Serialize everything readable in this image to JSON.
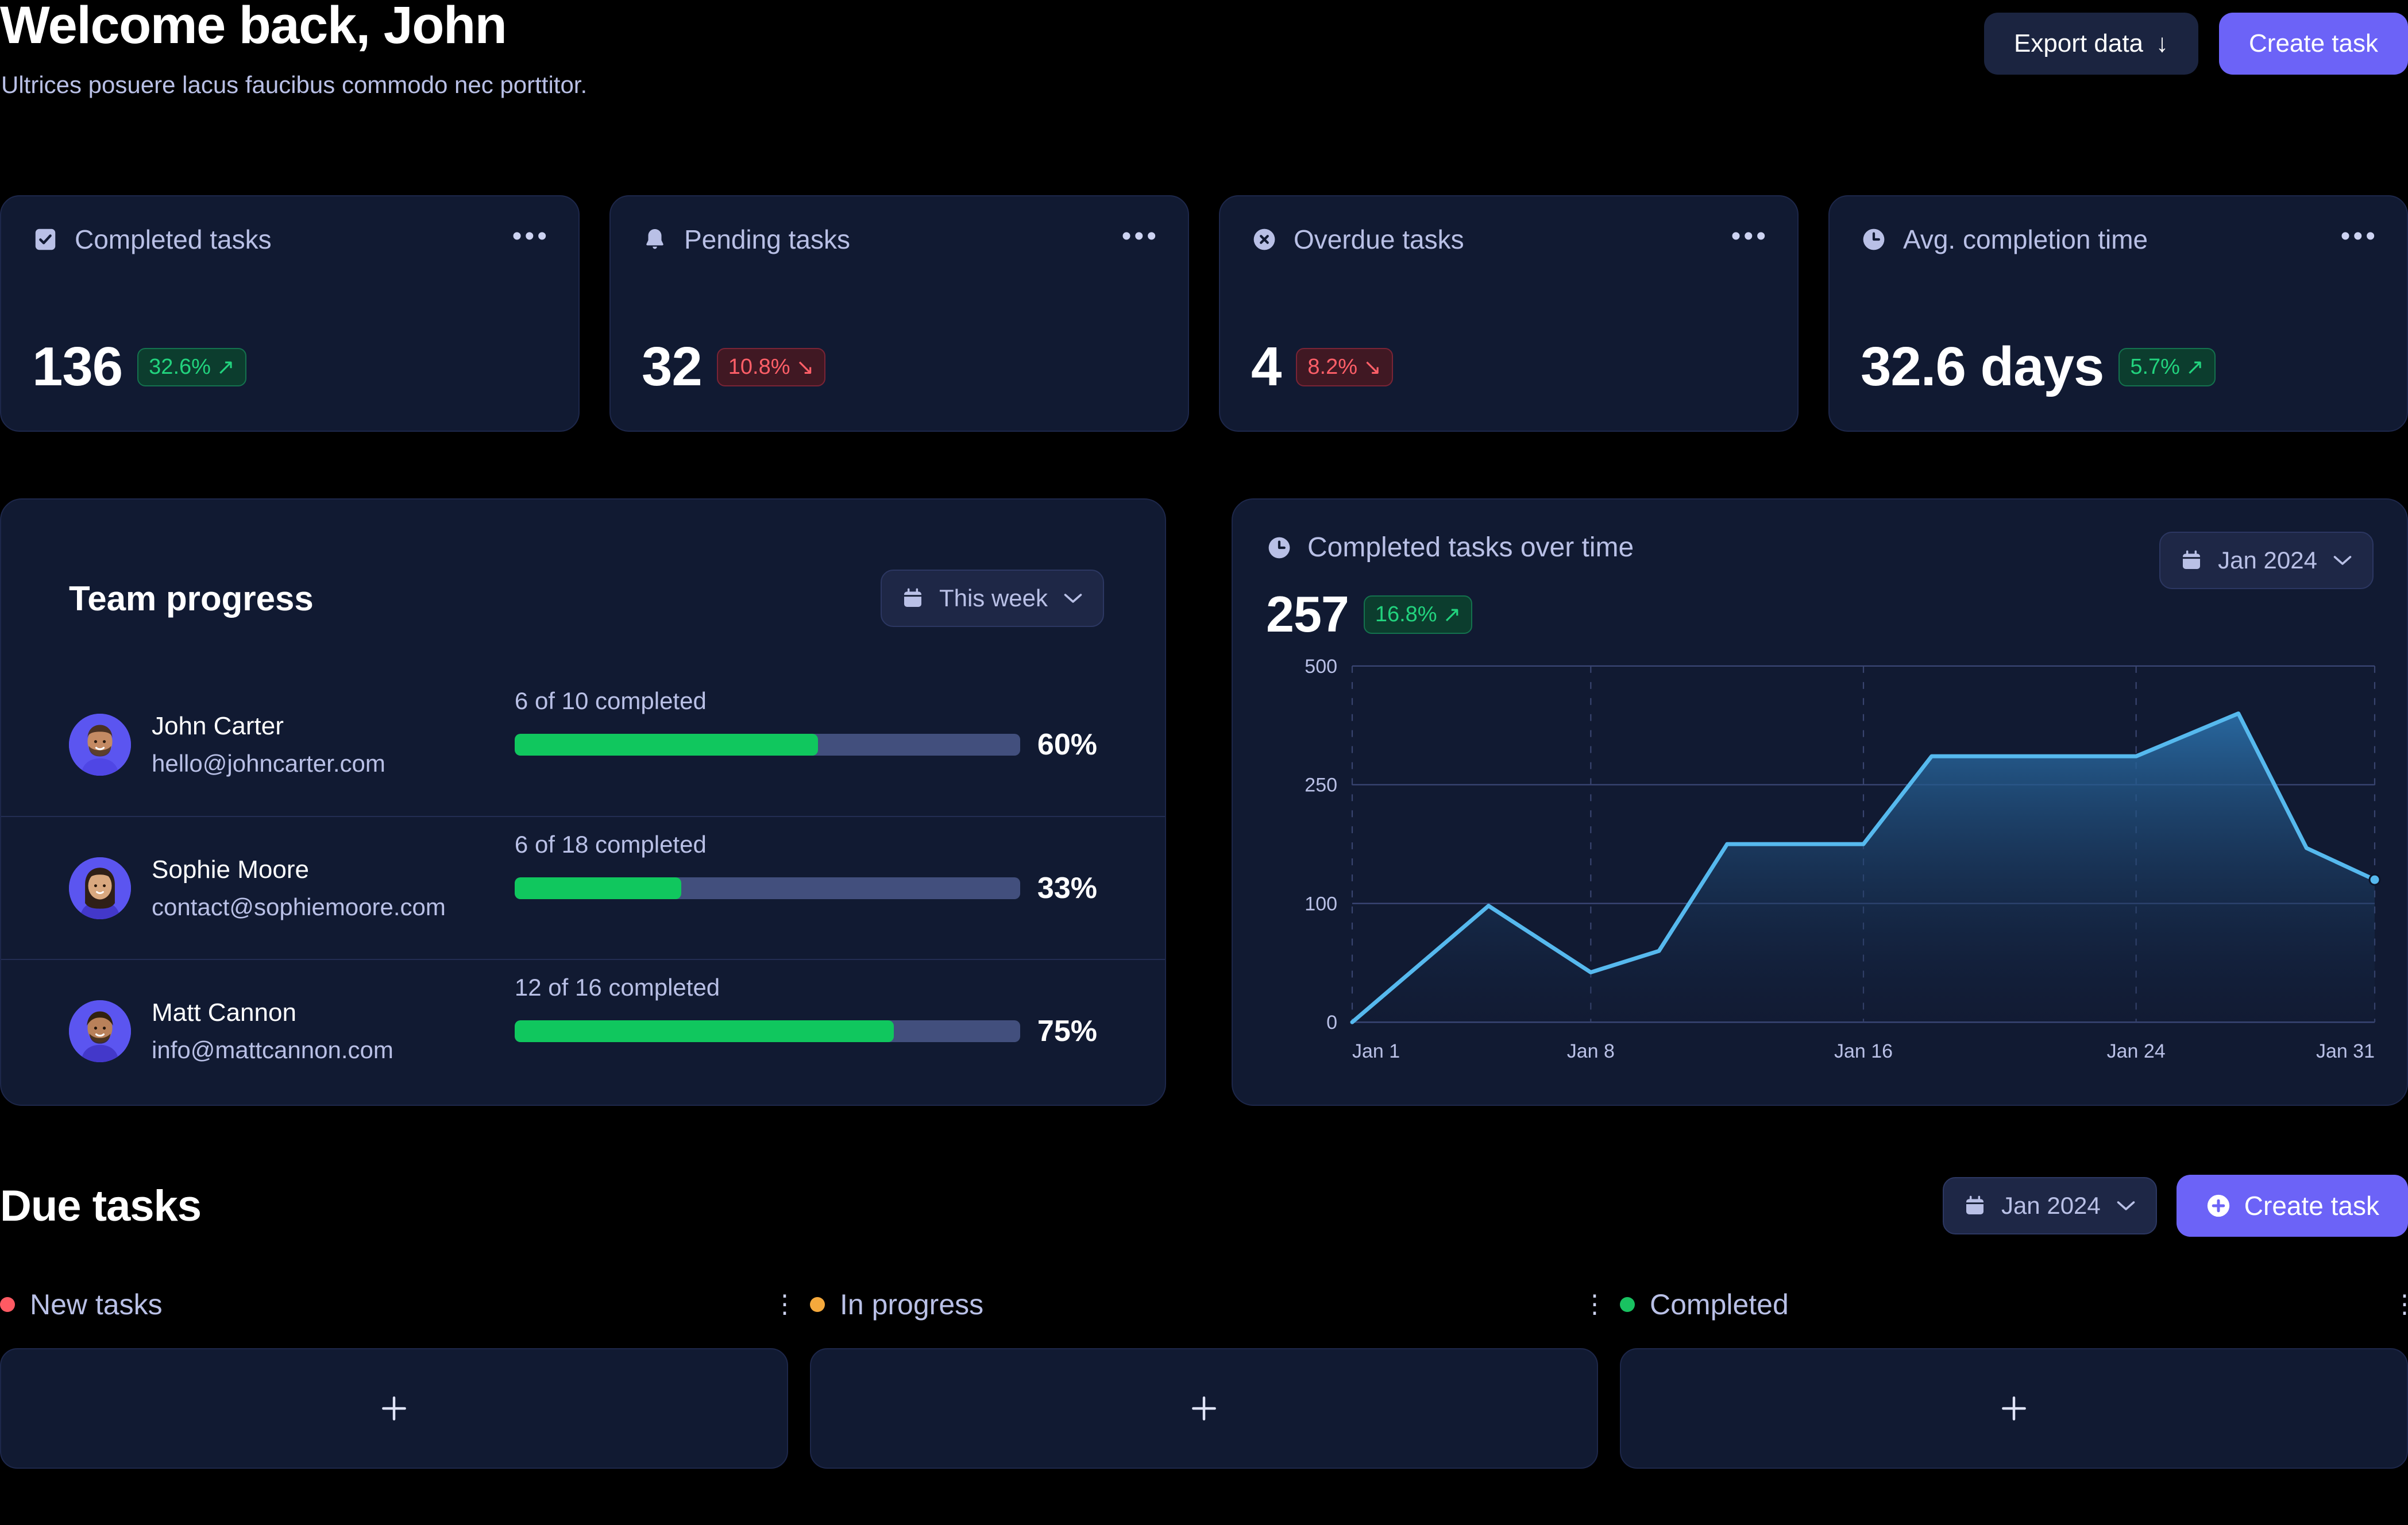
{
  "header": {
    "title": "Welcome back, John",
    "subtitle": "Ultrices posuere lacus faucibus commodo nec porttitor.",
    "export_label": "Export data",
    "export_icon": "download-arrow-icon",
    "create_label": "Create task"
  },
  "stats": [
    {
      "icon": "checkbox-icon",
      "label": "Completed tasks",
      "value": "136",
      "delta": "32.6%",
      "trend": "up",
      "trend_icon": "arrow-up-right-icon"
    },
    {
      "icon": "bell-icon",
      "label": "Pending tasks",
      "value": "32",
      "delta": "10.8%",
      "trend": "down",
      "trend_icon": "arrow-down-right-icon"
    },
    {
      "icon": "x-circle-icon",
      "label": "Overdue tasks",
      "value": "4",
      "delta": "8.2%",
      "trend": "down",
      "trend_icon": "arrow-down-right-icon"
    },
    {
      "icon": "clock-icon",
      "label": "Avg. completion time",
      "value": "32.6 days",
      "delta": "5.7%",
      "trend": "up",
      "trend_icon": "arrow-up-right-icon"
    }
  ],
  "stat_menu_icon": "more-horizontal-icon",
  "team": {
    "title": "Team progress",
    "range_selector": {
      "icon": "calendar-icon",
      "value": "This week",
      "chevron": "chevron-down-icon"
    },
    "members": [
      {
        "name": "John Carter",
        "email": "hello@johncarter.com",
        "progress_text": "6 of 10 completed",
        "percent": 60,
        "percent_label": "60%",
        "avatar": "avatar-john-carter"
      },
      {
        "name": "Sophie Moore",
        "email": "contact@sophiemoore.com",
        "progress_text": "6 of 18 completed",
        "percent": 33,
        "percent_label": "33%",
        "avatar": "avatar-sophie-moore"
      },
      {
        "name": "Matt Cannon",
        "email": "info@mattcannon.com",
        "progress_text": "12 of 16 completed",
        "percent": 75,
        "percent_label": "75%",
        "avatar": "avatar-matt-cannon"
      }
    ]
  },
  "chart_panel": {
    "icon": "clock-icon",
    "title": "Completed tasks over time",
    "total": "257",
    "delta": "16.8%",
    "trend": "up",
    "month_selector": {
      "icon": "calendar-icon",
      "value": "Jan 2024",
      "chevron": "chevron-down-icon"
    }
  },
  "chart_data": {
    "type": "area",
    "title": "Completed tasks over time",
    "xlabel": "",
    "ylabel": "",
    "grid": true,
    "legend": false,
    "ytick_labels": [
      "0",
      "100",
      "250",
      "500"
    ],
    "ytick_values": [
      0,
      100,
      250,
      500
    ],
    "yaxis_scale": "piecewise-even-spacing",
    "xtick_labels": [
      "Jan 1",
      "Jan 8",
      "Jan 16",
      "Jan 24",
      "Jan 31"
    ],
    "xtick_days": [
      1,
      8,
      16,
      24,
      31
    ],
    "xlim": [
      1,
      31
    ],
    "line_color": "#56b9ee",
    "fill_gradient": [
      "#2a6ea8",
      "#13203c"
    ],
    "end_marker": true,
    "series": [
      {
        "name": "Completed tasks",
        "x": [
          1,
          5,
          8,
          10,
          12,
          16,
          18,
          24,
          27,
          29,
          31
        ],
        "values": [
          0,
          98,
          42,
          60,
          175,
          175,
          310,
          310,
          400,
          170,
          130
        ]
      }
    ]
  },
  "due": {
    "title": "Due tasks",
    "month_selector": {
      "icon": "calendar-icon",
      "value": "Jan 2024",
      "chevron": "chevron-down-icon"
    },
    "create_label": "Create task",
    "create_icon": "plus-circle-icon",
    "columns": [
      {
        "label": "New tasks",
        "dot_color": "#ff5a63",
        "menu_icon": "more-vertical-icon",
        "add_icon": "plus-icon"
      },
      {
        "label": "In progress",
        "dot_color": "#f5a93c",
        "menu_icon": "more-vertical-icon",
        "add_icon": "plus-icon"
      },
      {
        "label": "Completed",
        "dot_color": "#19c261",
        "menu_icon": "more-vertical-icon",
        "add_icon": "plus-icon"
      }
    ]
  },
  "colors": {
    "background": "#000000",
    "card": "#111a32",
    "card_border": "#1d274a",
    "accent": "#6c63f7",
    "text_muted": "#b9c0e6",
    "green": "#22d37e",
    "red": "#ff5f68",
    "chart_line": "#56b9ee"
  }
}
